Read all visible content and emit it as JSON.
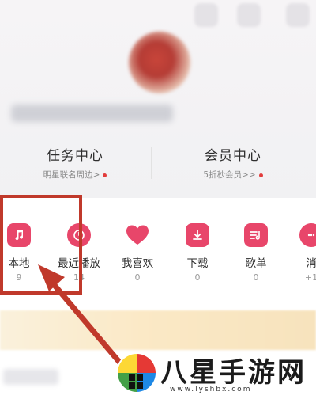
{
  "profile": {
    "task_center": {
      "title": "任务中心",
      "subtitle": "明星联名周边>"
    },
    "vip_center": {
      "title": "会员中心",
      "subtitle": "5折秒会员>>"
    }
  },
  "quick_access": [
    {
      "label": "本地",
      "count": "9",
      "icon": "music-note-icon"
    },
    {
      "label": "最近播放",
      "count": "14",
      "icon": "clock-icon"
    },
    {
      "label": "我喜欢",
      "count": "0",
      "icon": "heart-icon"
    },
    {
      "label": "下载",
      "count": "0",
      "icon": "download-icon"
    },
    {
      "label": "歌单",
      "count": "0",
      "icon": "playlist-icon"
    },
    {
      "label": "消",
      "count": "+1",
      "icon": "message-icon"
    }
  ],
  "watermark": {
    "text": "八星手游网",
    "url": "www.lyshbx.com"
  },
  "colors": {
    "accent": "#e8466a",
    "annotation": "#c0392b",
    "dot": "#e23c3c"
  }
}
